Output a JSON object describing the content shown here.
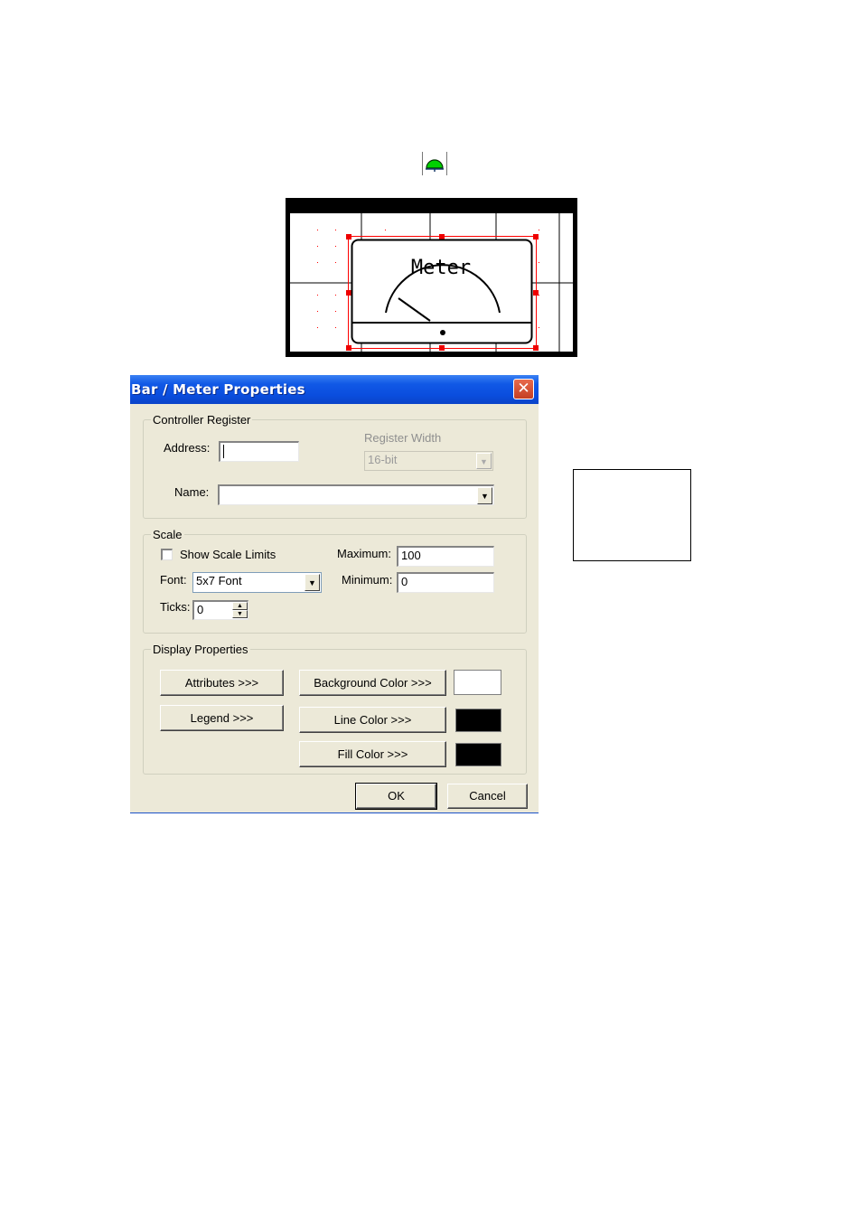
{
  "toolbar": {
    "meter_tool_icon": "meter-gauge-icon",
    "icon_color": "#00c000"
  },
  "preview": {
    "meter_title": "Meter"
  },
  "dialog": {
    "title": "Bar / Meter Properties",
    "close_glyph": "✕",
    "controller_register": {
      "legend": "Controller Register",
      "address_label": "Address:",
      "address_value": "",
      "register_width_label": "Register Width",
      "register_width_value": "16-bit",
      "name_label": "Name:",
      "name_value": ""
    },
    "scale": {
      "legend": "Scale",
      "show_scale_limits_label": "Show Scale Limits",
      "show_scale_limits_checked": false,
      "font_label": "Font:",
      "font_value": "5x7 Font",
      "ticks_label": "Ticks:",
      "ticks_value": "0",
      "maximum_label": "Maximum:",
      "maximum_value": "100",
      "minimum_label": "Minimum:",
      "minimum_value": "0"
    },
    "display_properties": {
      "legend": "Display Properties",
      "attributes_button": "Attributes >>>",
      "legend_button": "Legend >>>",
      "background_color_button": "Background Color >>>",
      "line_color_button": "Line Color >>>",
      "fill_color_button": "Fill Color >>>",
      "background_color": "#ffffff",
      "line_color": "#000000",
      "fill_color": "#000000"
    },
    "ok_button": "OK",
    "cancel_button": "Cancel"
  }
}
